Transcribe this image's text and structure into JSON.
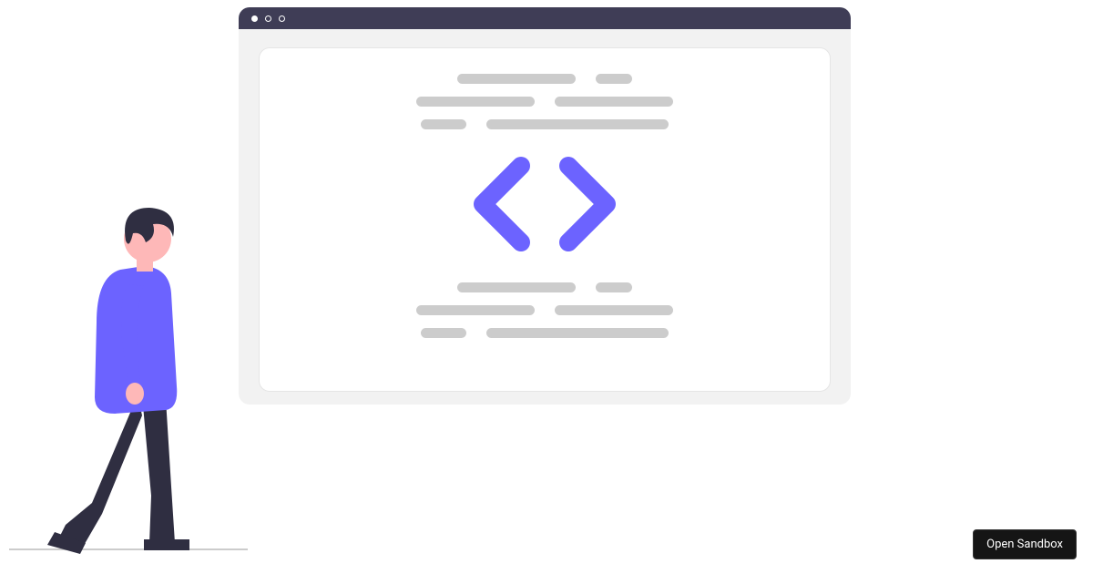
{
  "browser": {
    "icon": "code-brackets-icon",
    "accent_color": "#6c63ff",
    "placeholder_color": "#cccccc",
    "header_color": "#3f3d56"
  },
  "illustration": {
    "name": "walking-person",
    "colors": {
      "skin": "#feb8b8",
      "hair": "#2f2e41",
      "shirt": "#6c63ff",
      "pants": "#2f2e41",
      "shoes": "#2f2e41"
    }
  },
  "button": {
    "open_sandbox": "Open Sandbox"
  }
}
